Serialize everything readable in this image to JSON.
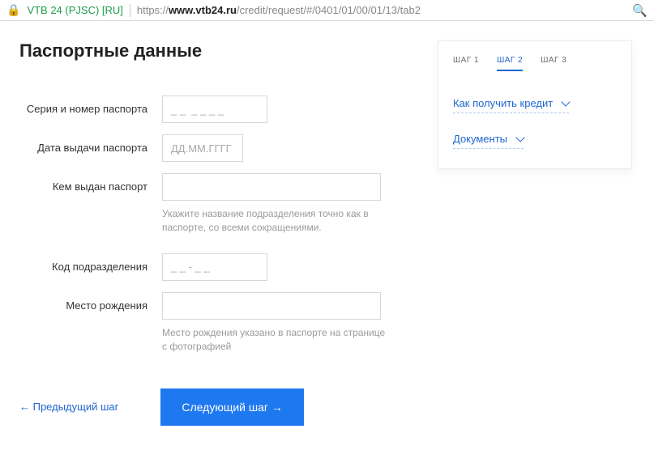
{
  "browser": {
    "org": "VTB 24 (PJSC) [RU]",
    "url_prefix": "https://",
    "url_host": "www.vtb24.ru",
    "url_path": "/credit/request/#/0401/01/00/01/13/tab2"
  },
  "heading": "Паспортные данные",
  "fields": {
    "passport_sn": {
      "label": "Серия и номер паспорта",
      "placeholder": "_ _  _ _ _ _"
    },
    "issue_date": {
      "label": "Дата выдачи паспорта",
      "placeholder": "ДД.ММ.ГГГГ"
    },
    "issuer": {
      "label": "Кем выдан паспорт",
      "hint": "Укажите название подразделения точно как в паспорте, со всеми сокращениями."
    },
    "dept_code": {
      "label": "Код подразделения",
      "placeholder": "_ _ - _ _"
    },
    "birth_place": {
      "label": "Место рождения",
      "hint": "Место рождения указано в паспорте на странице с фотографией"
    }
  },
  "actions": {
    "prev": "← Предыдущий шаг",
    "next": "Следующий шаг →"
  },
  "sidebar": {
    "steps": [
      "ШАГ 1",
      "ШАГ 2",
      "ШАГ 3"
    ],
    "active_step": 1,
    "links": [
      "Как получить кредит",
      "Документы"
    ]
  }
}
